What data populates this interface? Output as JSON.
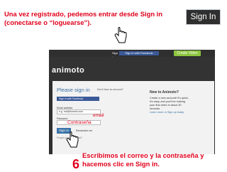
{
  "caption_top": "Una vez registrado, pedemos entrar desde Sign in (conectarse o “loguearse”).",
  "callout_label": "Sign In",
  "caption_bottom": "Escribimos el correo y la contraseña y hacemos clic en Sign in.",
  "step_number": "6",
  "topbar": {
    "signin": "Sign in",
    "fb_login": "Sign in with Facebook",
    "create_video": "Create Video"
  },
  "logo": "animoto",
  "form": {
    "title": "Please sign in",
    "dont_have_account": "Don't have an account?",
    "fb_button": "Sign in with Facebook",
    "email_label": "Email address",
    "email_value": "e.g. me@domain.com",
    "email_overlay": "email",
    "password_label": "Password",
    "password_overlay": "Contraseña",
    "signin_button": "Sign In",
    "remember": "Remember me",
    "forgot": "Forgot your password?"
  },
  "info": {
    "title": "New to Animoto?",
    "description": "Create a new account! It's quick, it's easy, and you'll be making your first video in about 30 seconds.",
    "learn_more": "Learn more or Sign up today"
  },
  "colors": {
    "accent_red": "#e0001b",
    "facebook_blue": "#3b5998",
    "create_green": "#8cc63f",
    "signin_blue": "#3b73a8"
  }
}
